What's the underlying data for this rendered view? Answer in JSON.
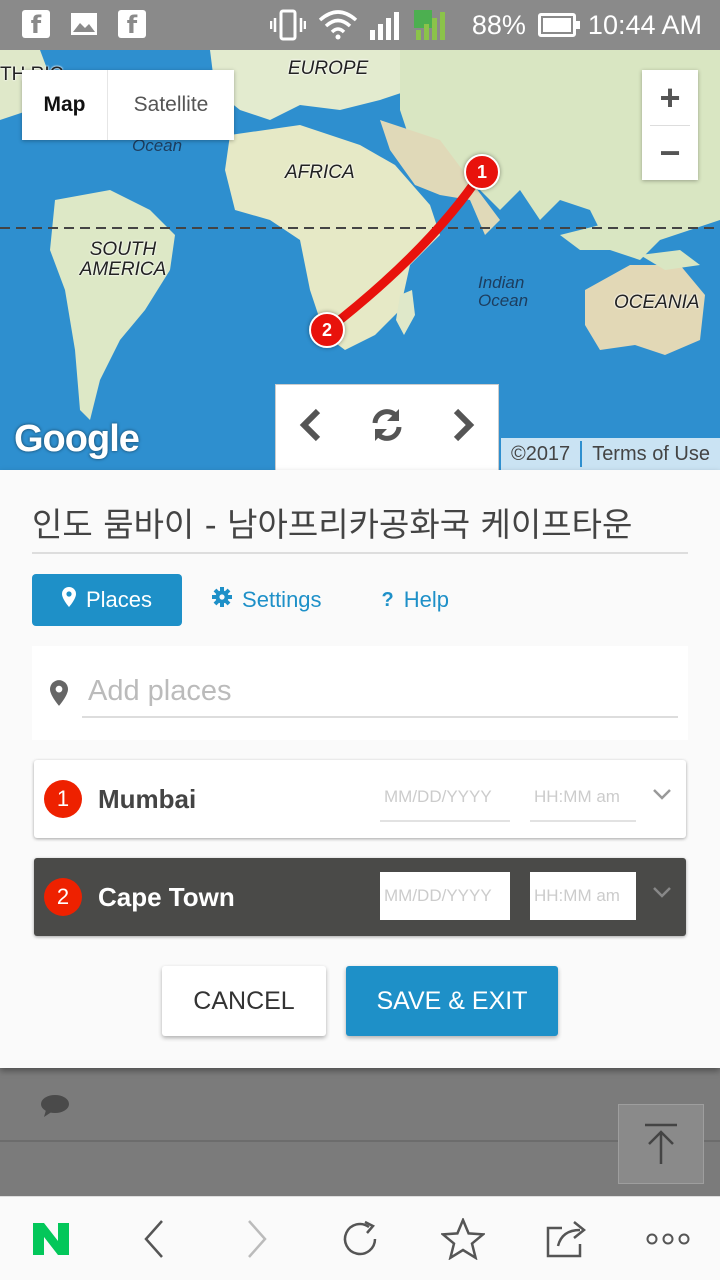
{
  "status_bar": {
    "battery": "88%",
    "time": "10:44 AM",
    "notification_icons": [
      "facebook-icon",
      "gallery-icon",
      "facebook-icon"
    ],
    "system_icons": [
      "vibrate-icon",
      "wifi-icon",
      "signal-icon",
      "battery-icon"
    ]
  },
  "map": {
    "type_map": "Map",
    "type_satellite": "Satellite",
    "zoom_in": "+",
    "zoom_out": "−",
    "logo": "Google",
    "copyright": "©2017",
    "terms": "Terms of Use",
    "labels": {
      "europe": "EUROPE",
      "africa": "AFRICA",
      "south_america": "SOUTH AMERICA",
      "oceania": "OCEANIA",
      "indian_ocean": "Indian Ocean",
      "ocean": "Ocean",
      "north_america_partial": "TH RIC"
    },
    "markers": [
      "1",
      "2"
    ]
  },
  "panel": {
    "route_title": "인도 뭄바이 - 남아프리카공화국 케이프타운",
    "tabs": [
      {
        "label": "Places",
        "icon": "pin-icon",
        "active": true
      },
      {
        "label": "Settings",
        "icon": "gear-icon",
        "active": false
      },
      {
        "label": "Help",
        "icon": "question-icon",
        "active": false
      }
    ],
    "add_placeholder": "Add places",
    "places": [
      {
        "num": "1",
        "name": "Mumbai",
        "date_placeholder": "MM/DD/YYYY",
        "time_placeholder": "HH:MM am"
      },
      {
        "num": "2",
        "name": "Cape Town",
        "date_placeholder": "MM/DD/YYYY",
        "time_placeholder": "HH:MM am"
      }
    ],
    "cancel": "CANCEL",
    "save": "SAVE & EXIT"
  },
  "colors": {
    "accent": "#1e90c8",
    "marker_red": "#e8120c",
    "ocean": "#2e8fcf",
    "land": "#e3ebcf",
    "selected_row": "#4a4a48",
    "naver_green": "#03c75a"
  },
  "toolbar": {
    "items": [
      "naver-logo",
      "back-icon",
      "forward-icon",
      "refresh-icon",
      "star-icon",
      "share-icon",
      "more-icon"
    ]
  }
}
